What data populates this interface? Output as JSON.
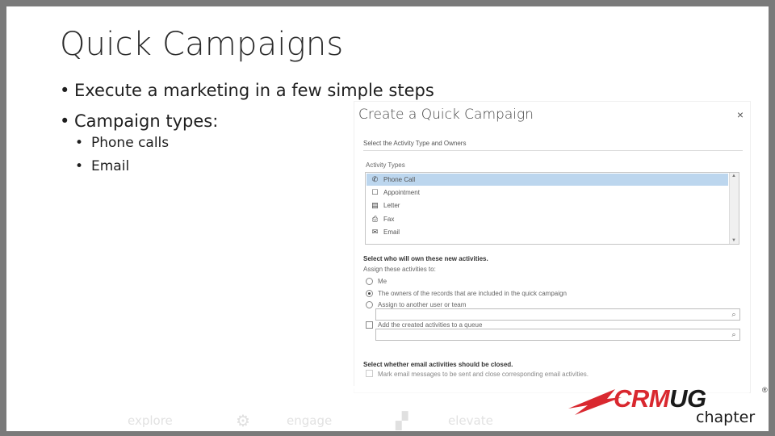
{
  "slide": {
    "title": "Quick Campaigns",
    "bullets": [
      "Execute a marketing in a few simple steps",
      "Campaign types:"
    ],
    "sub_bullets": [
      "Phone calls",
      "Email"
    ]
  },
  "dialog": {
    "title": "Create a Quick Campaign",
    "close_icon": "×",
    "subtitle": "Select the Activity Type and Owners",
    "activity_types_label": "Activity Types",
    "activity_types": [
      {
        "label": "Phone Call",
        "icon": "phone-icon",
        "selected": true
      },
      {
        "label": "Appointment",
        "icon": "calendar-icon",
        "selected": false
      },
      {
        "label": "Letter",
        "icon": "letter-icon",
        "selected": false
      },
      {
        "label": "Fax",
        "icon": "fax-icon",
        "selected": false
      },
      {
        "label": "Email",
        "icon": "email-icon",
        "selected": false
      }
    ],
    "owners_heading": "Select who will own these new activities.",
    "assign_label": "Assign these activities to:",
    "options": {
      "me": "Me",
      "owners": "The owners of the records that are included in the quick campaign",
      "another": "Assign to another user or team"
    },
    "queue_label": "Add the created activities to a queue",
    "close_heading": "Select whether email activities should be closed.",
    "mark_sent_label": "Mark email messages to be sent and close corresponding email activities."
  },
  "footer": {
    "explore": "explore",
    "engage": "engage",
    "elevate": "elevate"
  },
  "logo": {
    "crm": "CRM",
    "ug": "UG",
    "registered": "®",
    "chapter": "chapter"
  },
  "colors": {
    "selected_row": "#bcd6ee",
    "logo_red": "#d9282f",
    "frame": "#7a7a7a"
  }
}
